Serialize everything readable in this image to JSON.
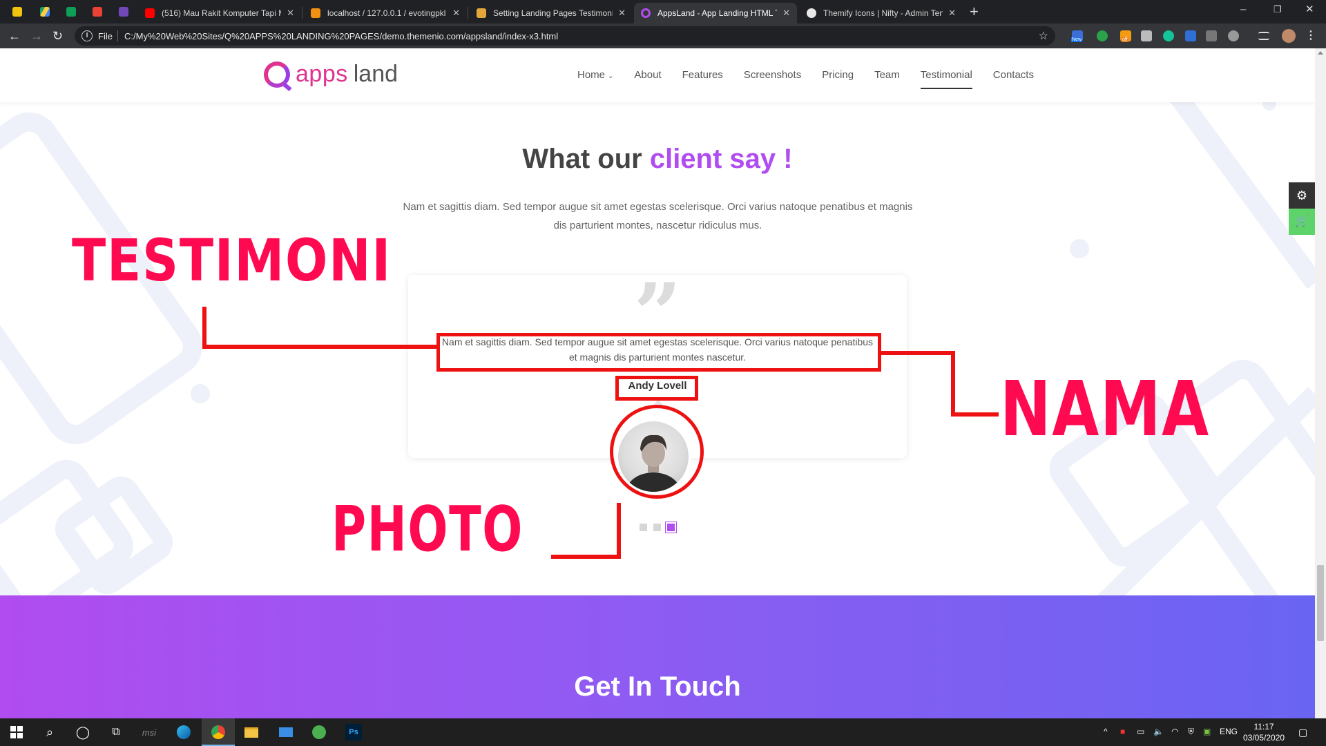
{
  "browser": {
    "tabs": [
      {
        "title": "(516) Mau Rakit Komputer Tapi M",
        "color": "#ff0000"
      },
      {
        "title": "localhost / 127.0.0.1 / evotingpkl",
        "color": "#f29111"
      },
      {
        "title": "Setting Landing Pages Testimoni",
        "color": "#e2a63b"
      },
      {
        "title": "AppsLand - App Landing HTML T",
        "color": "#b14cf0"
      },
      {
        "title": "Themify Icons | Nifty - Admin Ten",
        "color": "#e8e8e8"
      }
    ],
    "active_tab": 3,
    "address": {
      "scheme": "File",
      "url": "C:/My%20Web%20Sites/Q%20APPS%20LANDING%20PAGES/demo.themenio.com/appsland/index-x3.html"
    },
    "ext_badges": {
      "new": "New",
      "off": "off"
    }
  },
  "site": {
    "logo": {
      "apps": "apps",
      "land": "land"
    },
    "nav": [
      {
        "label": "Home",
        "has_caret": true
      },
      {
        "label": "About"
      },
      {
        "label": "Features"
      },
      {
        "label": "Screenshots"
      },
      {
        "label": "Pricing"
      },
      {
        "label": "Team"
      },
      {
        "label": "Testimonial",
        "active": true
      },
      {
        "label": "Contacts"
      }
    ]
  },
  "section": {
    "title_part1": "What our",
    "title_part2": "client say !",
    "subtitle": "Nam et sagittis diam. Sed tempor augue sit amet egestas scelerisque. Orci varius natoque penatibus et magnis dis parturient montes, nascetur ridiculus mus.",
    "testimonial": {
      "text": "Nam et sagittis diam. Sed tempor augue sit amet egestas scelerisque. Orci varius natoque penatibus et magnis dis parturient montes nascetur.",
      "name": "Andy Lovell"
    },
    "slider": {
      "count": 3,
      "active_index": 2
    }
  },
  "annotations": {
    "testimoni": "TESTIMONI",
    "nama": "NAMA",
    "photo": "PHOTO",
    "color": "#ff0a50"
  },
  "footer_band": {
    "title": "Get In Touch"
  },
  "taskbar": {
    "lang": "ENG",
    "time": "11:17",
    "date": "03/05/2020"
  }
}
